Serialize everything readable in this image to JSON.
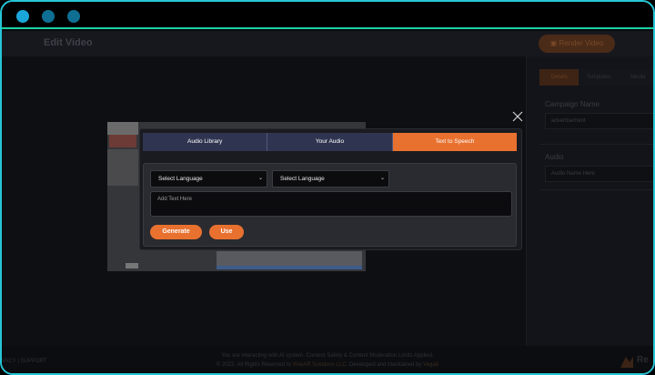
{
  "window": {
    "dots": [
      "traffic-dot-1",
      "traffic-dot-2",
      "traffic-dot-3"
    ]
  },
  "header": {
    "title": "Edit Video",
    "render_label": "Render Video"
  },
  "right_panel": {
    "tabs": [
      "Details",
      "Templates",
      "Media"
    ],
    "campaign_label": "Campaign Name",
    "campaign_value": "advertisement",
    "audio_label": "Audio",
    "audio_placeholder": "Audio Name Here"
  },
  "modal": {
    "tabs": [
      "Audio Library",
      "Your Audio",
      "Text to Speech"
    ],
    "active_tab": "Text to Speech",
    "select1_value": "Select Language",
    "select2_value": "Select Language",
    "textarea_placeholder": "Add Text Here",
    "generate_label": "Generate",
    "use_label": "Use"
  },
  "footer": {
    "left_links": "VACY | SUPPORT",
    "line1": "You are interacting with AI system. Content Safety & Content Moderation Limits Applied.",
    "line2_prefix": "© 2023, All Rights Reserved to ",
    "company": "VineAR Solutions LLC",
    "line2_mid": ". Developed and Maintained by ",
    "developer": "Vega6",
    "logo_text": "Re"
  },
  "colors": {
    "accent": "#e9712f",
    "tab_inactive": "#2f3550",
    "frame_border": "#25c6d6",
    "topbar_line": "#1ad1a5"
  }
}
